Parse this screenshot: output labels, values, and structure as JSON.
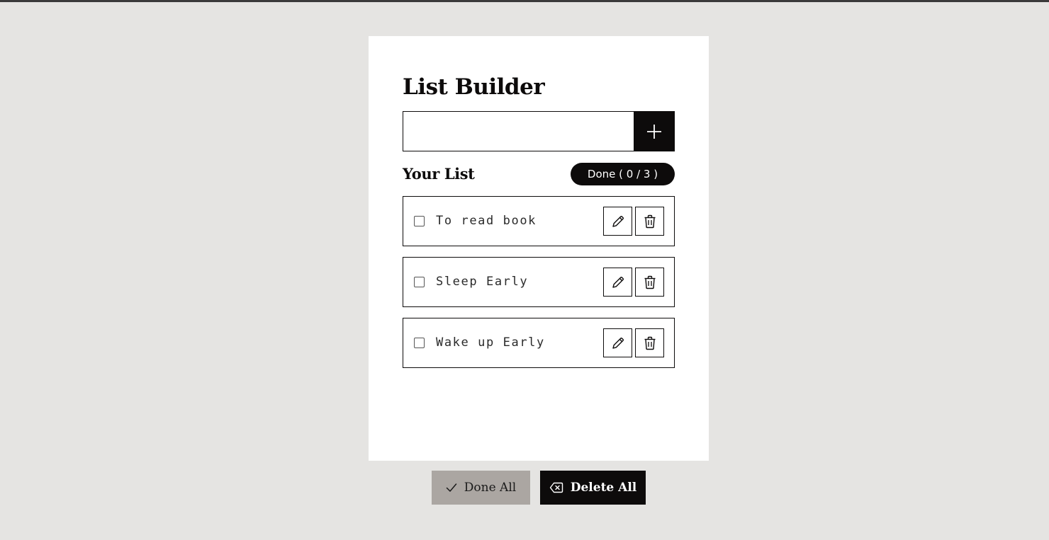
{
  "app": {
    "title": "List Builder"
  },
  "add": {
    "input_value": "",
    "placeholder": "",
    "button_icon": "plus-icon"
  },
  "list": {
    "title": "Your List",
    "done_badge": "Done ( 0 / 3 )",
    "items": [
      {
        "label": "To read book",
        "checked": false
      },
      {
        "label": "Sleep Early",
        "checked": false
      },
      {
        "label": "Wake up Early",
        "checked": false
      }
    ]
  },
  "actions": {
    "done_all_label": "Done All",
    "done_all_icon": "check-icon",
    "delete_all_label": "Delete All",
    "delete_all_icon": "backspace-icon"
  },
  "colors": {
    "background": "#e5e4e2",
    "card": "#ffffff",
    "ink": "#0d0b0b",
    "done_all_bg": "#aba6a2"
  }
}
